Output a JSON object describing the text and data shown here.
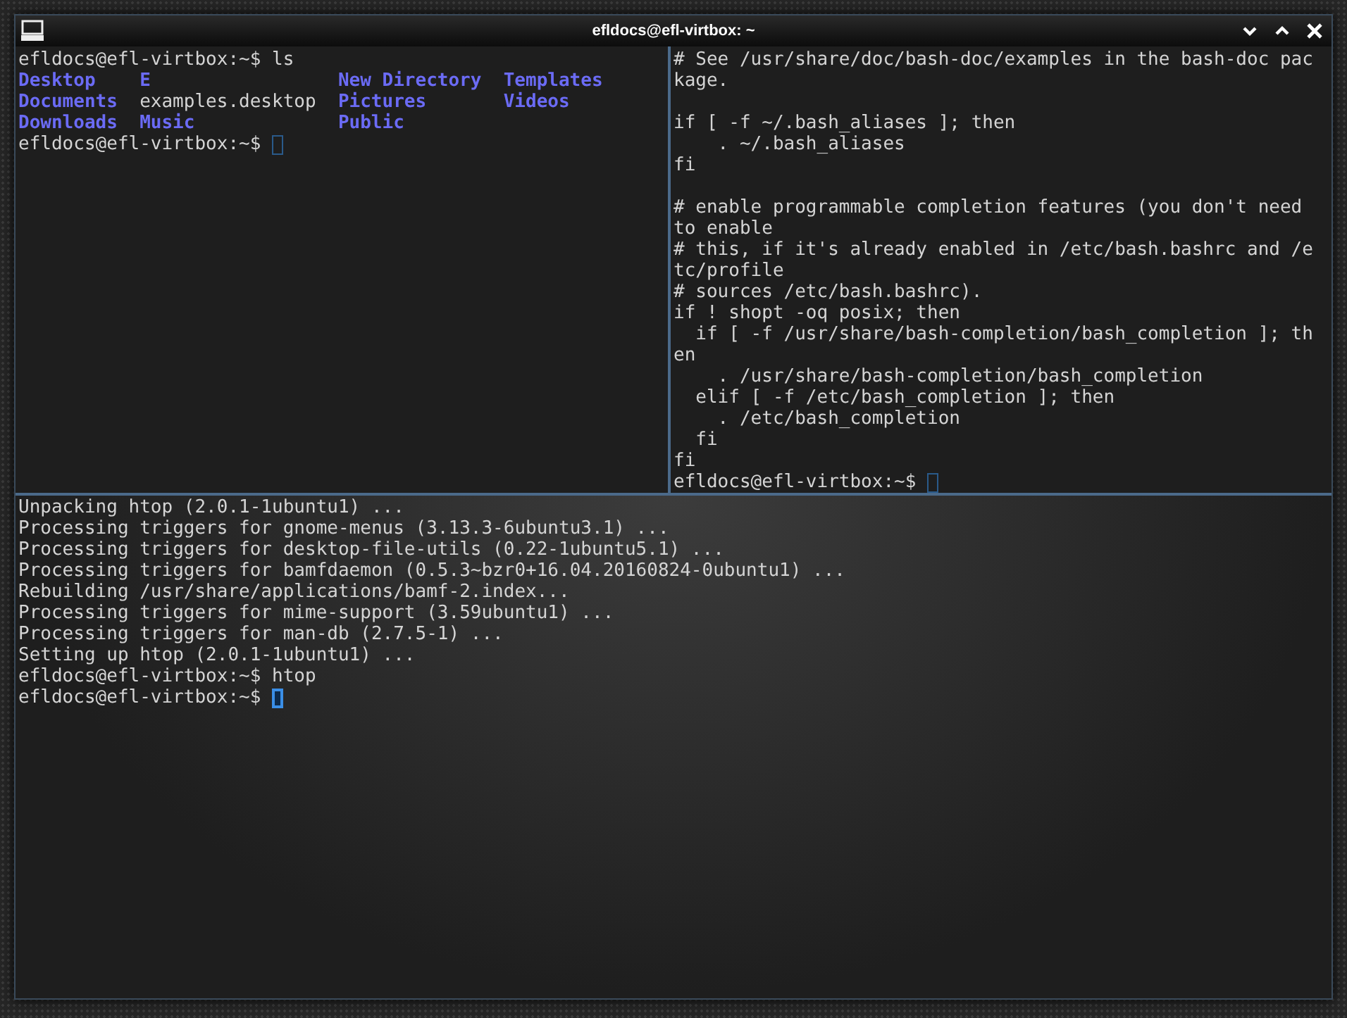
{
  "window": {
    "title": "efldocs@efl-virtbox: ~"
  },
  "top_left_pane": {
    "focused": false,
    "lines": [
      {
        "kind": "prompt",
        "text": "efldocs@efl-virtbox:~$ ls",
        "cursor": false
      },
      {
        "kind": "listing",
        "entries": [
          {
            "name": "Desktop",
            "kind": "directory"
          },
          {
            "name": "Documents",
            "kind": "directory"
          },
          {
            "name": "Downloads",
            "kind": "directory"
          },
          {
            "name": "E",
            "kind": "directory"
          },
          {
            "name": "examples.desktop",
            "kind": "file"
          },
          {
            "name": "Music",
            "kind": "directory"
          },
          {
            "name": "New Directory",
            "kind": "directory"
          },
          {
            "name": "Pictures",
            "kind": "directory"
          },
          {
            "name": "Public",
            "kind": "directory"
          },
          {
            "name": "Templates",
            "kind": "directory"
          },
          {
            "name": "Videos",
            "kind": "directory"
          }
        ]
      },
      {
        "kind": "prompt",
        "text": "efldocs@efl-virtbox:~$",
        "cursor": true
      }
    ]
  },
  "right_pane": {
    "focused": false,
    "lines": [
      {
        "kind": "text",
        "text": "# See /usr/share/doc/bash-doc/examples in the bash-doc pac"
      },
      {
        "kind": "text",
        "text": "kage."
      },
      {
        "kind": "blank"
      },
      {
        "kind": "text",
        "text": "if [ -f ~/.bash_aliases ]; then"
      },
      {
        "kind": "text",
        "text": "    . ~/.bash_aliases"
      },
      {
        "kind": "text",
        "text": "fi"
      },
      {
        "kind": "blank"
      },
      {
        "kind": "text",
        "text": "# enable programmable completion features (you don't need"
      },
      {
        "kind": "text",
        "text": "to enable"
      },
      {
        "kind": "text",
        "text": "# this, if it's already enabled in /etc/bash.bashrc and /e"
      },
      {
        "kind": "text",
        "text": "tc/profile"
      },
      {
        "kind": "text",
        "text": "# sources /etc/bash.bashrc)."
      },
      {
        "kind": "text",
        "text": "if ! shopt -oq posix; then"
      },
      {
        "kind": "text",
        "text": "  if [ -f /usr/share/bash-completion/bash_completion ]; th"
      },
      {
        "kind": "text",
        "text": "en"
      },
      {
        "kind": "text",
        "text": "    . /usr/share/bash-completion/bash_completion"
      },
      {
        "kind": "text",
        "text": "  elif [ -f /etc/bash_completion ]; then"
      },
      {
        "kind": "text",
        "text": "    . /etc/bash_completion"
      },
      {
        "kind": "text",
        "text": "  fi"
      },
      {
        "kind": "text",
        "text": "fi"
      },
      {
        "kind": "prompt",
        "text": "efldocs@efl-virtbox:~$",
        "cursor": true
      }
    ]
  },
  "bottom_pane": {
    "focused": true,
    "lines": [
      {
        "kind": "text",
        "text": "Unpacking htop (2.0.1-1ubuntu1) ..."
      },
      {
        "kind": "text",
        "text": "Processing triggers for gnome-menus (3.13.3-6ubuntu3.1) ..."
      },
      {
        "kind": "text",
        "text": "Processing triggers for desktop-file-utils (0.22-1ubuntu5.1) ..."
      },
      {
        "kind": "text",
        "text": "Processing triggers for bamfdaemon (0.5.3~bzr0+16.04.20160824-0ubuntu1) ..."
      },
      {
        "kind": "text",
        "text": "Rebuilding /usr/share/applications/bamf-2.index..."
      },
      {
        "kind": "text",
        "text": "Processing triggers for mime-support (3.59ubuntu1) ..."
      },
      {
        "kind": "text",
        "text": "Processing triggers for man-db (2.7.5-1) ..."
      },
      {
        "kind": "text",
        "text": "Setting up htop (2.0.1-1ubuntu1) ..."
      },
      {
        "kind": "prompt",
        "text": "efldocs@efl-virtbox:~$ htop",
        "cursor": false
      },
      {
        "kind": "prompt",
        "text": "efldocs@efl-virtbox:~$",
        "cursor": true
      }
    ]
  }
}
